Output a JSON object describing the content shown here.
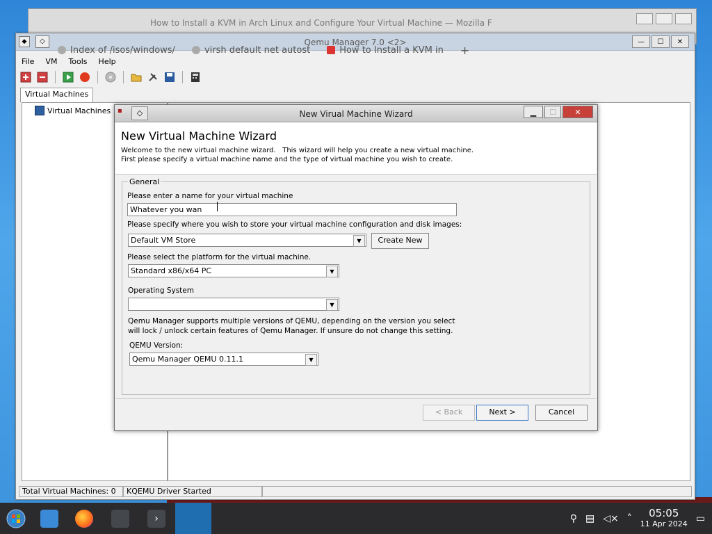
{
  "background_window": {
    "title": "How to Install a KVM in Arch Linux and Configure Your Virtual Machine — Mozilla F"
  },
  "main_window": {
    "title": "Qemu Manager 7.0 <2>",
    "browser_tabs": [
      {
        "label": "Index of /isos/windows/"
      },
      {
        "label": "virsh default net autost"
      },
      {
        "label": "How to Install a KVM in"
      }
    ],
    "new_tab_label": "+",
    "menu": [
      {
        "label": "File"
      },
      {
        "label": "VM"
      },
      {
        "label": "Tools"
      },
      {
        "label": "Help"
      }
    ],
    "tab_label": "Virtual Machines",
    "tree_root_label": "Virtual Machines",
    "status": {
      "total_vms": "Total Virtual Machines: 0",
      "driver": "KQEMU Driver Started"
    }
  },
  "wizard": {
    "titlebar_title": "New Virual Machine Wizard",
    "heading": "New Virtual Machine Wizard",
    "description_line1": "Welcome to the new virtual machine wizard.   This wizard will help you create a new virtual machine.",
    "description_line2": "First please specify a virtual machine name and the type of virtual machine you wish to create.",
    "group_label": "General",
    "name_label": "Please enter a name for your virtual machine",
    "name_value": "Whatever you wan",
    "store_label": "Please specify where you wish to store your virtual machine configuration and disk images:",
    "store_value": "Default VM Store",
    "create_new_label": "Create New",
    "platform_label": "Please select the platform for the virtual machine.",
    "platform_value": "Standard x86/x64 PC",
    "os_label": "Operating System",
    "os_value": "",
    "qemu_note_line1": "Qemu Manager supports multiple versions of QEMU, depending on the version you select",
    "qemu_note_line2": "will lock / unlock certain features of Qemu Manager. If unsure do not change this setting.",
    "qemu_version_label": "QEMU Version:",
    "qemu_version_value": "Qemu Manager QEMU 0.11.1",
    "back_label": "< Back",
    "next_label": "Next >",
    "cancel_label": "Cancel",
    "close_glyph": "✕"
  },
  "taskbar": {
    "clock_time": "05:05",
    "clock_date": "11 Apr 2024"
  },
  "colors": {
    "taskbar_bg": "#2b2b2e",
    "active_task": "#1f6fb0",
    "close_button": "#c8403a"
  }
}
